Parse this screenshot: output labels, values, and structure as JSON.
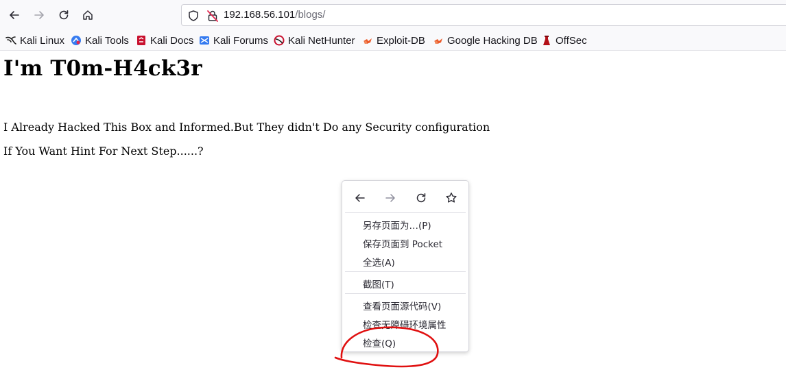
{
  "browser": {
    "url_host": "192.168.56.101",
    "url_path": "/blogs/",
    "bookmarks": [
      {
        "label": "Kali Linux",
        "icon": "kali-dragon-icon"
      },
      {
        "label": "Kali Tools",
        "icon": "kali-tools-icon"
      },
      {
        "label": "Kali Docs",
        "icon": "kali-docs-icon"
      },
      {
        "label": "Kali Forums",
        "icon": "kali-forums-icon"
      },
      {
        "label": "Kali NetHunter",
        "icon": "kali-nethunter-icon"
      },
      {
        "label": "Exploit-DB",
        "icon": "exploit-db-icon"
      },
      {
        "label": "Google Hacking DB",
        "icon": "ghdb-icon"
      },
      {
        "label": "OffSec",
        "icon": "offsec-icon"
      }
    ]
  },
  "page": {
    "heading": "I'm T0m-H4ck3r",
    "para1": "I Already Hacked This Box and Informed.But They didn't Do any Security configuration",
    "para2": "If You Want Hint For Next Step......?"
  },
  "context_menu": {
    "items": [
      {
        "label": "另存页面为…(P)"
      },
      {
        "label": "保存页面到 Pocket"
      },
      {
        "label": "全选(A)"
      },
      {
        "label": "截图(T)"
      },
      {
        "label": "查看页面源代码(V)"
      },
      {
        "label": "检查无障碍环境属性"
      },
      {
        "label": "检查(Q)"
      }
    ]
  },
  "colors": {
    "chrome_bg": "#f9f9fb",
    "annotation_red": "#e01010",
    "kali_blue": "#367bf0",
    "exploit_orange": "#ec5a29",
    "offsec_red": "#b31017"
  }
}
